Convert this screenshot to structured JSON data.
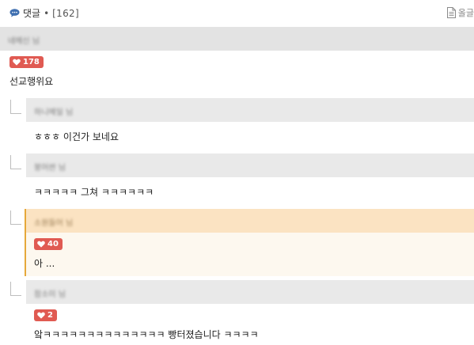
{
  "header": {
    "icon": "speech-bubble-icon",
    "label": "댓글",
    "separator": "•",
    "count": "[162]",
    "doc_icon": "document-icon",
    "doc_label": "올글"
  },
  "colors": {
    "like_badge": "#e05a52",
    "highlight_bar": "#fbe3c2",
    "highlight_border": "#e6a83a",
    "author_bar": "#e9e9e9"
  },
  "comments": [
    {
      "author": "네메신 님",
      "likes": "178",
      "text": "선교행위요"
    },
    {
      "author": "하니메일 님",
      "text": "ㅎㅎㅎ 이건가 보네요"
    },
    {
      "author": "붕어싼 님",
      "text": "ㅋㅋㅋㅋㅋ 그쳐 ㅋㅋㅋㅋㅋㅋ"
    },
    {
      "author": "소원들어 님",
      "likes": "40",
      "text": "아 ..."
    },
    {
      "author": "잠소미 님",
      "likes": "2",
      "text": "앜ㅋㅋㅋㅋㅋㅋㅋㅋㅋㅋㅋㅋㅋㅋ 빵터졌습니다 ㅋㅋㅋㅋ"
    }
  ]
}
